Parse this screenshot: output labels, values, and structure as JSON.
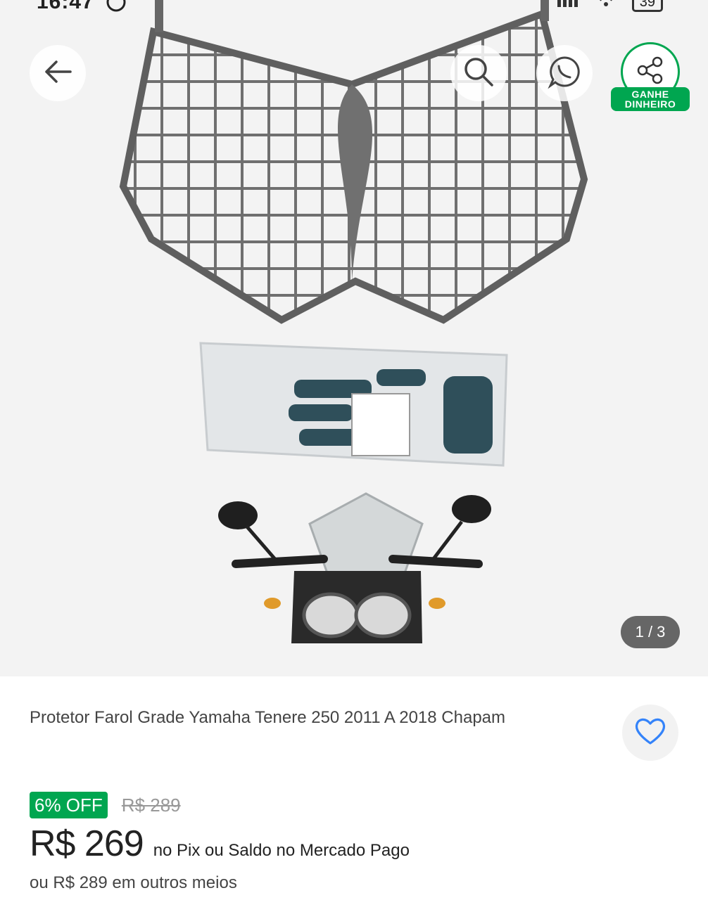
{
  "status_bar": {
    "time": "16:47",
    "battery": "39"
  },
  "toolbar": {
    "back_icon": "arrow-left-icon",
    "search_icon": "search-icon",
    "whatsapp_icon": "whatsapp-share-icon",
    "share_icon": "share-icon",
    "share_label_line1": "GANHE",
    "share_label_line2": "DINHEIRO"
  },
  "gallery": {
    "counter": "1 / 3"
  },
  "product": {
    "title": "Protetor Farol Grade Yamaha Tenere 250 2011 A 2018 Chapam",
    "discount": "6% OFF",
    "old_price": "R$ 289",
    "price": "R$ 269",
    "price_note": "no Pix ou Saldo no Mercado Pago",
    "other_means": "ou R$ 289 em outros meios"
  },
  "colors": {
    "accent_green": "#00a650",
    "favorite_blue": "#3483fa"
  }
}
